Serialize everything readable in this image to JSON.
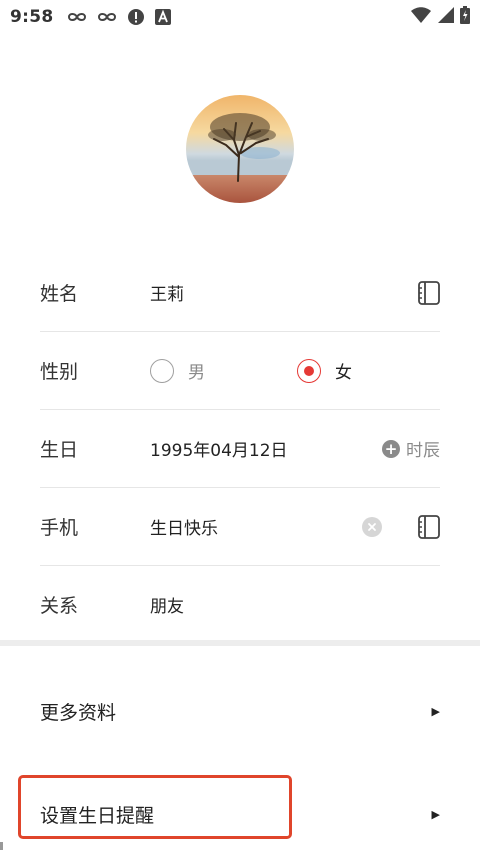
{
  "status_bar": {
    "time": "9:58",
    "left_icons": [
      "link-icon",
      "link-icon",
      "alert-icon",
      "a-icon"
    ],
    "right_icons": [
      "wifi-icon",
      "signal-icon",
      "battery-icon"
    ]
  },
  "avatar": {
    "icon": "tree-avatar-image"
  },
  "form": {
    "name": {
      "label": "姓名",
      "value": "王莉"
    },
    "gender": {
      "label": "性别",
      "options": [
        "男",
        "女"
      ],
      "selected": "女"
    },
    "birthday": {
      "label": "生日",
      "value": "1995年04月12日",
      "shichen": "时辰"
    },
    "phone": {
      "label": "手机",
      "value": "生日快乐"
    },
    "relation": {
      "label": "关系",
      "value": "朋友"
    }
  },
  "menu": {
    "more": "更多资料",
    "reminder": "设置生日提醒"
  },
  "colors": {
    "accent": "#e53935",
    "highlight": "#e0452b",
    "divider": "#e6e6e6"
  }
}
